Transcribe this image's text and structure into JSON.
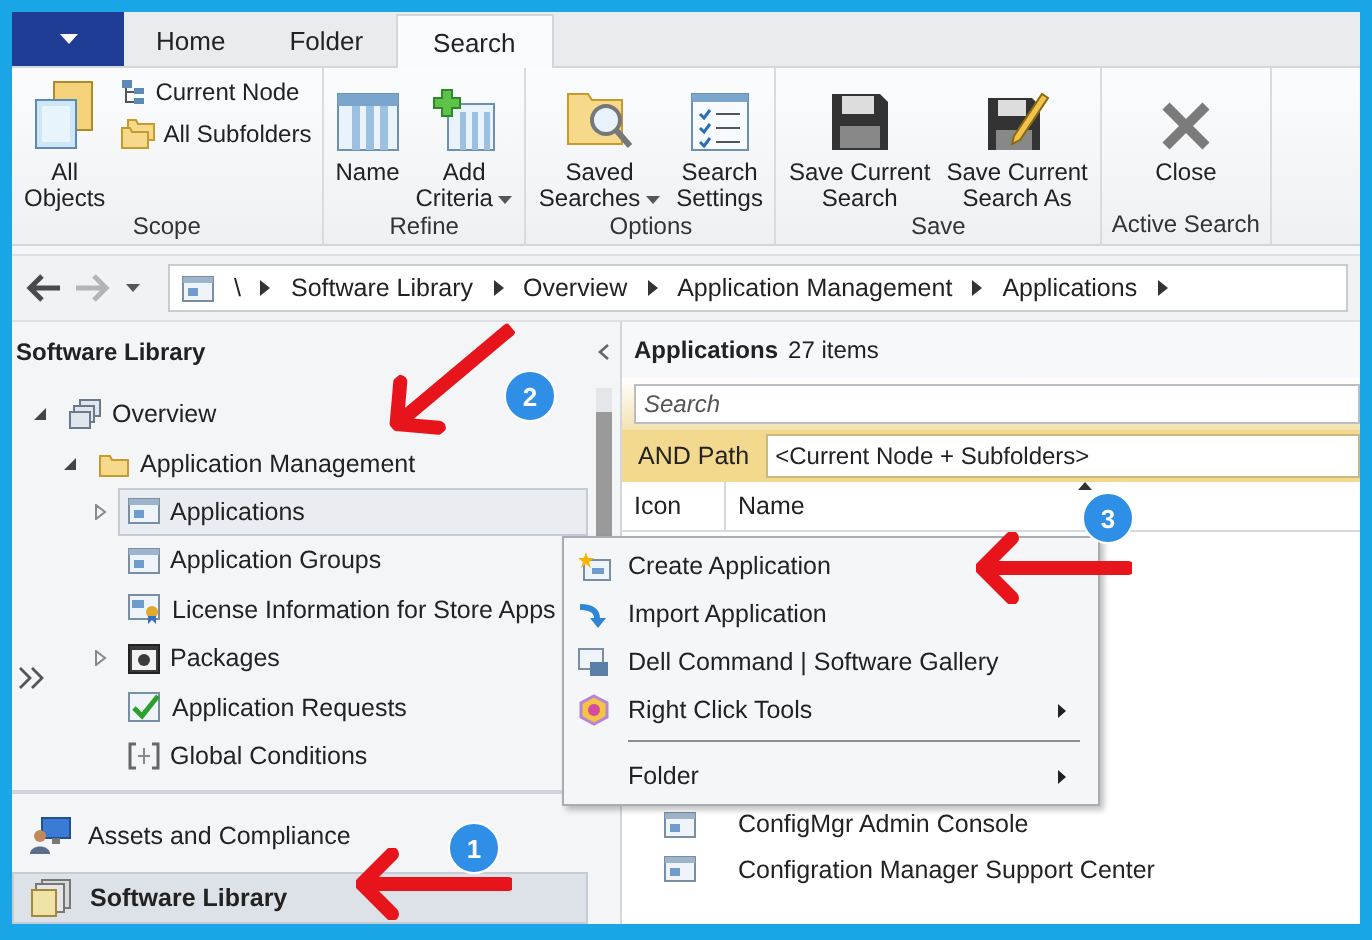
{
  "tabs": [
    {
      "label": "Home",
      "selected": false
    },
    {
      "label": "Folder",
      "selected": false
    },
    {
      "label": "Search",
      "selected": true
    }
  ],
  "ribbon": [
    {
      "label": "Scope",
      "buttons": [
        {
          "kind": "large",
          "lines": [
            "All",
            "Objects"
          ],
          "dropdown": false
        },
        {
          "kind": "small",
          "lines": [
            "Current Node"
          ],
          "dropdown": false
        },
        {
          "kind": "small",
          "lines": [
            "All Subfolders"
          ],
          "dropdown": false
        }
      ]
    },
    {
      "label": "Refine",
      "buttons": [
        {
          "kind": "large",
          "lines": [
            "Name"
          ],
          "dropdown": false
        },
        {
          "kind": "large",
          "lines": [
            "Add",
            "Criteria"
          ],
          "dropdown": true
        }
      ]
    },
    {
      "label": "Options",
      "buttons": [
        {
          "kind": "large",
          "lines": [
            "Saved",
            "Searches"
          ],
          "dropdown": true
        },
        {
          "kind": "large",
          "lines": [
            "Search",
            "Settings"
          ],
          "dropdown": false
        }
      ]
    },
    {
      "label": "Save",
      "buttons": [
        {
          "kind": "large",
          "lines": [
            "Save Current",
            "Search"
          ],
          "dropdown": false
        },
        {
          "kind": "large",
          "lines": [
            "Save Current",
            "Search As"
          ],
          "dropdown": false
        }
      ]
    },
    {
      "label": "Active Search",
      "buttons": [
        {
          "kind": "large",
          "lines": [
            "Close"
          ],
          "dropdown": false
        }
      ]
    }
  ],
  "address": [
    "\\",
    "Software Library",
    "Overview",
    "Application Management",
    "Applications"
  ],
  "tree": {
    "title": "Software Library",
    "items": [
      {
        "label": "Overview",
        "expanded": true,
        "selected": false,
        "children": [
          {
            "label": "Application Management",
            "expanded": true,
            "selected": false,
            "children": [
              {
                "label": "Applications",
                "expanded": false,
                "selected": true
              },
              {
                "label": "Application Groups",
                "selected": false
              },
              {
                "label": "License Information for Store Apps",
                "selected": false
              },
              {
                "label": "Packages",
                "expanded": false,
                "selected": false
              },
              {
                "label": "Application Requests",
                "selected": false
              },
              {
                "label": "Global Conditions",
                "selected": false
              }
            ]
          }
        ]
      }
    ]
  },
  "workspaces": [
    {
      "label": "Assets and Compliance",
      "selected": false
    },
    {
      "label": "Software Library",
      "selected": true
    }
  ],
  "list": {
    "title": "Applications",
    "count": "27 items",
    "search": {
      "placeholder": "Search"
    },
    "path": {
      "label": "AND Path",
      "value": "<Current Node + Subfolders>"
    },
    "columns": [
      "Icon",
      "Name"
    ],
    "rows": [
      {
        "name": "ConfigMgr Admin Console"
      },
      {
        "name": "Configration Manager Support Center"
      }
    ]
  },
  "context_menu": [
    {
      "label": "Create Application",
      "submenu": false,
      "separator_before": false
    },
    {
      "label": "Import Application",
      "submenu": false,
      "separator_before": false
    },
    {
      "label": "Dell Command | Software Gallery",
      "submenu": false,
      "separator_before": false
    },
    {
      "label": "Right Click Tools",
      "submenu": true,
      "separator_before": false
    },
    {
      "label": "Folder",
      "submenu": true,
      "separator_before": true
    }
  ],
  "annotations": [
    {
      "number": "1"
    },
    {
      "number": "2"
    },
    {
      "number": "3"
    }
  ]
}
